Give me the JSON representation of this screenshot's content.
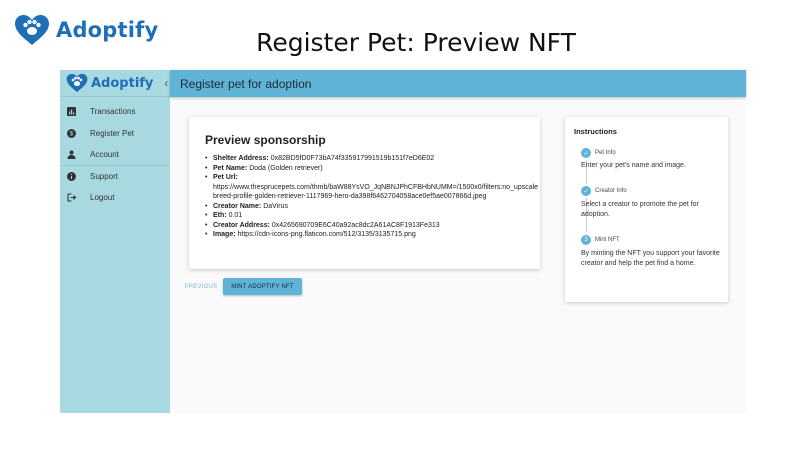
{
  "slide": {
    "brand": "Adoptify",
    "title": "Register Pet: Preview NFT"
  },
  "sidebar": {
    "brand": "Adoptify",
    "collapse_glyph": "‹",
    "items": [
      {
        "label": "Transactions",
        "icon": "chart-icon"
      },
      {
        "label": "Register Pet",
        "icon": "dollar-icon"
      },
      {
        "label": "Account",
        "icon": "person-icon"
      },
      {
        "label": "Support",
        "icon": "info-icon"
      },
      {
        "label": "Logout",
        "icon": "logout-icon"
      }
    ]
  },
  "topbar": {
    "title": "Register pet for adoption"
  },
  "preview": {
    "heading": "Preview sponsorship",
    "shelter_address_label": "Shelter Address:",
    "shelter_address": "0x82BD5fD0F73bA74f335917991519b151f7eD6E02",
    "pet_name_label": "Pet Name:",
    "pet_name": "Doda (Golden retriever)",
    "pet_url_label": "Pet Url:",
    "pet_url_line1": "https://www.thesprucepets.com/thmb/baW88YsVO_JqNBNJPhCFBHbNUMM=/1500x0/filters:no_upscale",
    "pet_url_line2": "breed-profile-golden-retriever-1117969-hero-da398f6462704058ace0ef5ae007866d.jpeg",
    "creator_name_label": "Creator Name:",
    "creator_name": "DaVirus",
    "eth_label": "Eth:",
    "eth": "0.01",
    "creator_address_label": "Creator Address:",
    "creator_address": "0x4265690709E6C40a92ac8dc2A61AC8F1913Fe313",
    "image_label": "Image:",
    "image": "https://cdn-icons-png.flaticon.com/512/3135/3135715.png"
  },
  "actions": {
    "previous": "PREVIOUS",
    "mint": "MINT ADOPTIFY NFT"
  },
  "instructions": {
    "title": "Instructions",
    "steps": [
      {
        "label": "Pet Info",
        "desc": "Enter your pet's name and image.",
        "marker": "✓"
      },
      {
        "label": "Creator Info",
        "desc": "Select a creator to promote the pet for adoption.",
        "marker": "✓"
      },
      {
        "label": "Mint NFT",
        "desc": "By minting the NFT you support your favorite creator and help the pet find a home.",
        "marker": "3"
      }
    ]
  },
  "colors": {
    "brand_blue": "#1f6fb8",
    "topbar": "#5fb3d6",
    "sidebar": "#a9d9e0"
  }
}
